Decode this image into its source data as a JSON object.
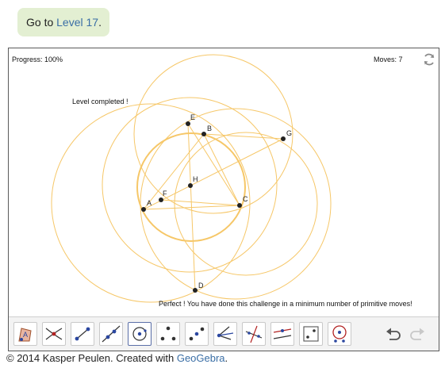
{
  "banner": {
    "prefix": "Go to ",
    "link": "Level 17",
    "suffix": "."
  },
  "status": {
    "progress": "Progress: 100%",
    "moves": "Moves: 7"
  },
  "messages": {
    "completed": "Level completed !",
    "perfect": "Perfect ! You have done this challenge in a minimum number of primitive moves!"
  },
  "points": {
    "A": "A",
    "B": "B",
    "C": "C",
    "D": "D",
    "E": "E",
    "F": "F",
    "G": "G",
    "H": "H"
  },
  "tools": [
    {
      "name": "move-tool-icon"
    },
    {
      "name": "intersect-tool-icon"
    },
    {
      "name": "segment-tool-icon"
    },
    {
      "name": "line-tool-icon"
    },
    {
      "name": "circle-tool-icon",
      "selected": true
    },
    {
      "name": "triangle-tool-icon"
    },
    {
      "name": "midpoint-tool-icon"
    },
    {
      "name": "angle-bisector-tool-icon"
    },
    {
      "name": "perpendicular-bisector-tool-icon"
    },
    {
      "name": "parallel-line-tool-icon"
    },
    {
      "name": "square-tool-icon"
    },
    {
      "name": "circle-center-point-tool-icon"
    }
  ],
  "footer": {
    "prefix": "© 2014 Kasper Peulen. Created with ",
    "link": "GeoGebra",
    "suffix": "."
  },
  "colors": {
    "construction": "#f6c768",
    "point": "#222222",
    "banner_bg": "#e3efd2",
    "link": "#3a6ea5"
  }
}
